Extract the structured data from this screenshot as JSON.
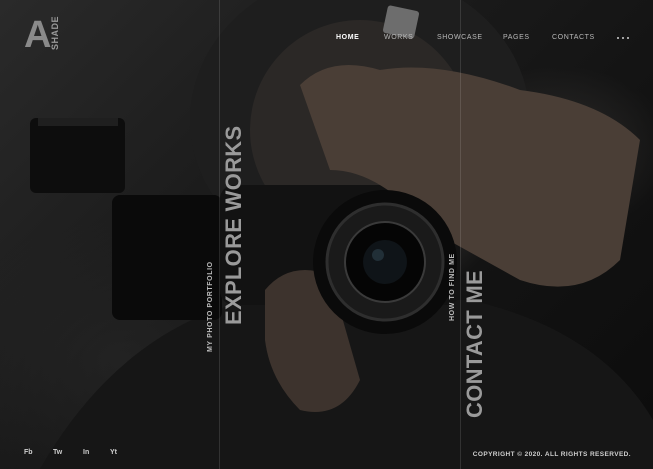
{
  "logo": {
    "letter": "A",
    "subtitle": "SHADE"
  },
  "nav": {
    "items": [
      {
        "label": "HOME",
        "active": true
      },
      {
        "label": "WORKS",
        "active": false
      },
      {
        "label": "SHOWCASE",
        "active": false
      },
      {
        "label": "PAGES",
        "active": false
      },
      {
        "label": "CONTACTS",
        "active": false
      }
    ],
    "more_icon": "more-dots-icon"
  },
  "panels": {
    "portfolio": {
      "small": "MY PHOTO PORTFOLIO",
      "big": "EXPLORE WORKS"
    },
    "contact": {
      "small": "HOW TO FIND ME",
      "big": "CONTACT ME"
    }
  },
  "social": [
    "Fb",
    "Tw",
    "In",
    "Yt"
  ],
  "footer": {
    "copyright": "COPYRIGHT © 2020. ALL RIGHTS RESERVED."
  },
  "colors": {
    "background": "#111111",
    "accent_text": "#9a9a9a",
    "active_nav": "#ffffff"
  }
}
